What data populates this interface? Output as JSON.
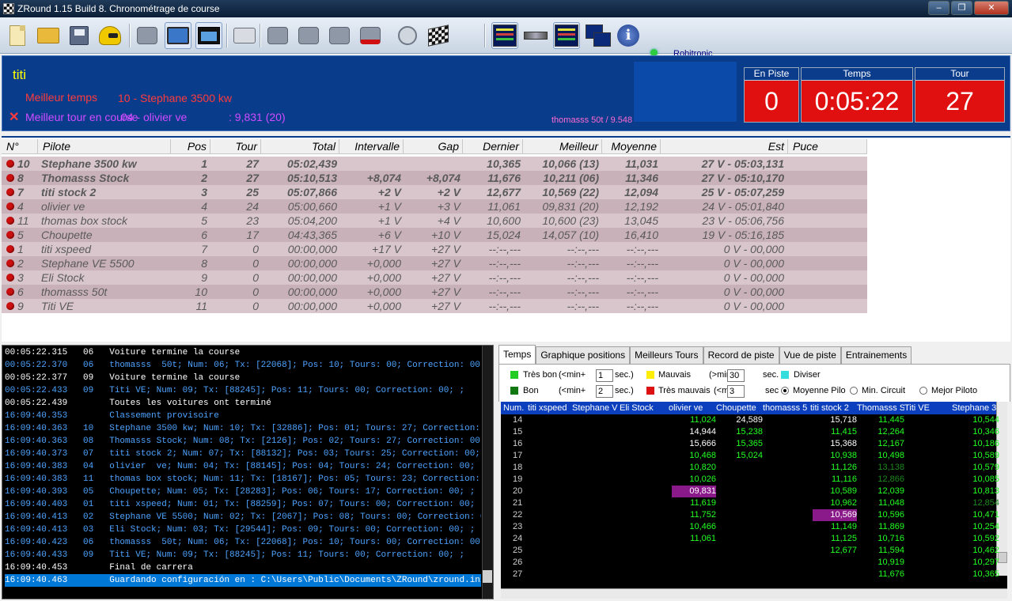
{
  "window": {
    "title": "ZRound 1.15 Build 8. Chronométrage de course"
  },
  "toolbar": {
    "brand": "Robitronic"
  },
  "header": {
    "name": "titi",
    "best_time_label": "Meilleur temps",
    "best_time_value": "10 - Stephane 3500 kw",
    "best_lap_label": "Meilleur tour en course",
    "best_lap_name": "04 - olivier  ve",
    "best_lap_value": ": 9,831 (20)",
    "record": "thomasss  50t / 9.548",
    "stats": [
      {
        "label": "En Piste",
        "value": "0"
      },
      {
        "label": "Temps",
        "value": "0:05:22"
      },
      {
        "label": "Tour",
        "value": "27"
      }
    ]
  },
  "table": {
    "columns": [
      "N°",
      "Pilote",
      "Pos",
      "Tour",
      "Total",
      "Intervalle",
      "Gap",
      "Dernier",
      "Meilleur",
      "Moyenne",
      "Est",
      "Puce"
    ],
    "rows": [
      {
        "num": "10",
        "pilote": "Stephane 3500 kw",
        "pos": "1",
        "tour": "27",
        "total": "05:02,439",
        "interval": "",
        "gap": "",
        "dernier": "10,365",
        "meilleur": "10,066 (13)",
        "moyenne": "11,031",
        "est": "27 V - 05:03,131",
        "bold": true
      },
      {
        "num": "8",
        "pilote": "Thomasss Stock",
        "pos": "2",
        "tour": "27",
        "total": "05:10,513",
        "interval": "+8,074",
        "gap": "+8,074",
        "dernier": "11,676",
        "meilleur": "10,211 (06)",
        "moyenne": "11,346",
        "est": "27 V - 05:10,170",
        "bold": true
      },
      {
        "num": "7",
        "pilote": "titi stock 2",
        "pos": "3",
        "tour": "25",
        "total": "05:07,866",
        "interval": "+2 V",
        "gap": "+2 V",
        "dernier": "12,677",
        "meilleur": "10,569 (22)",
        "moyenne": "12,094",
        "est": "25 V - 05:07,259",
        "bold": true
      },
      {
        "num": "4",
        "pilote": "olivier  ve",
        "pos": "4",
        "tour": "24",
        "total": "05:00,660",
        "interval": "+1 V",
        "gap": "+3 V",
        "dernier": "11,061",
        "meilleur": "09,831 (20)",
        "moyenne": "12,192",
        "est": "24 V - 05:01,840",
        "bold": false
      },
      {
        "num": "11",
        "pilote": "thomas box stock",
        "pos": "5",
        "tour": "23",
        "total": "05:04,200",
        "interval": "+1 V",
        "gap": "+4 V",
        "dernier": "10,600",
        "meilleur": "10,600 (23)",
        "moyenne": "13,045",
        "est": "23 V - 05:06,756",
        "bold": false
      },
      {
        "num": "5",
        "pilote": "Choupette",
        "pos": "6",
        "tour": "17",
        "total": "04:43,365",
        "interval": "+6 V",
        "gap": "+10 V",
        "dernier": "15,024",
        "meilleur": "14,057 (10)",
        "moyenne": "16,410",
        "est": "19 V - 05:16,185",
        "bold": false
      },
      {
        "num": "1",
        "pilote": "titi xspeed",
        "pos": "7",
        "tour": "0",
        "total": "00:00,000",
        "interval": "+17 V",
        "gap": "+27 V",
        "dernier": "--:--,---",
        "meilleur": "--:--,---",
        "moyenne": "--:--,---",
        "est": "0 V - 00,000",
        "bold": false
      },
      {
        "num": "2",
        "pilote": "Stephane VE 5500",
        "pos": "8",
        "tour": "0",
        "total": "00:00,000",
        "interval": "+0,000",
        "gap": "+27 V",
        "dernier": "--:--,---",
        "meilleur": "--:--,---",
        "moyenne": "--:--,---",
        "est": "0 V - 00,000",
        "bold": false
      },
      {
        "num": "3",
        "pilote": "Eli Stock",
        "pos": "9",
        "tour": "0",
        "total": "00:00,000",
        "interval": "+0,000",
        "gap": "+27 V",
        "dernier": "--:--,---",
        "meilleur": "--:--,---",
        "moyenne": "--:--,---",
        "est": "0 V - 00,000",
        "bold": false
      },
      {
        "num": "6",
        "pilote": "thomasss  50t",
        "pos": "10",
        "tour": "0",
        "total": "00:00,000",
        "interval": "+0,000",
        "gap": "+27 V",
        "dernier": "--:--,---",
        "meilleur": "--:--,---",
        "moyenne": "--:--,---",
        "est": "0 V - 00,000",
        "bold": false
      },
      {
        "num": "9",
        "pilote": "Titi VE",
        "pos": "11",
        "tour": "0",
        "total": "00:00,000",
        "interval": "+0,000",
        "gap": "+27 V",
        "dernier": "--:--,---",
        "meilleur": "--:--,---",
        "moyenne": "--:--,---",
        "est": "0 V - 00,000",
        "bold": false
      }
    ]
  },
  "log": [
    {
      "time": "00:05:22.315",
      "num": "06",
      "text": "Voiture termine la course",
      "color": "white"
    },
    {
      "time": "00:05:22.370",
      "num": "06",
      "text": "thomasss  50t; Num: 06; Tx: [22068]; Pos: 10; Tours: 00; Correction: 00; ;",
      "color": "blue"
    },
    {
      "time": "00:05:22.377",
      "num": "09",
      "text": "Voiture termine la course",
      "color": "white"
    },
    {
      "time": "00:05:22.433",
      "num": "09",
      "text": "Titi VE; Num: 09; Tx: [88245]; Pos: 11; Tours: 00; Correction: 00; ;",
      "color": "blue"
    },
    {
      "time": "00:05:22.439",
      "num": "",
      "text": "Toutes les voitures ont terminé",
      "color": "white"
    },
    {
      "time": "16:09:40.353",
      "num": "",
      "text": "Classement provisoire",
      "color": "blue"
    },
    {
      "time": "16:09:40.363",
      "num": "10",
      "text": "Stephane 3500 kw; Num: 10; Tx: [32886]; Pos: 01; Tours: 27; Correction: 00;",
      "color": "blue"
    },
    {
      "time": "16:09:40.363",
      "num": "08",
      "text": "Thomasss Stock; Num: 08; Tx: [2126]; Pos: 02; Tours: 27; Correction: 00; ;",
      "color": "blue"
    },
    {
      "time": "16:09:40.373",
      "num": "07",
      "text": "titi stock 2; Num: 07; Tx: [88132]; Pos: 03; Tours: 25; Correction: 00; ;",
      "color": "blue"
    },
    {
      "time": "16:09:40.383",
      "num": "04",
      "text": "olivier  ve; Num: 04; Tx: [88145]; Pos: 04; Tours: 24; Correction: 00; ;",
      "color": "blue"
    },
    {
      "time": "16:09:40.383",
      "num": "11",
      "text": "thomas box stock; Num: 11; Tx: [18167]; Pos: 05; Tours: 23; Correction: 00;",
      "color": "blue"
    },
    {
      "time": "16:09:40.393",
      "num": "05",
      "text": "Choupette; Num: 05; Tx: [28283]; Pos: 06; Tours: 17; Correction: 00; ;",
      "color": "blue"
    },
    {
      "time": "16:09:40.403",
      "num": "01",
      "text": "titi xspeed; Num: 01; Tx: [88259]; Pos: 07; Tours: 00; Correction: 00; ;",
      "color": "blue"
    },
    {
      "time": "16:09:40.413",
      "num": "02",
      "text": "Stephane VE 5500; Num: 02; Tx: [2067]; Pos: 08; Tours: 00; Correction: 00;",
      "color": "blue"
    },
    {
      "time": "16:09:40.413",
      "num": "03",
      "text": "Eli Stock; Num: 03; Tx: [29544]; Pos: 09; Tours: 00; Correction: 00; ;",
      "color": "blue"
    },
    {
      "time": "16:09:40.423",
      "num": "06",
      "text": "thomasss  50t; Num: 06; Tx: [22068]; Pos: 10; Tours: 00; Correction: 00; ;",
      "color": "blue"
    },
    {
      "time": "16:09:40.433",
      "num": "09",
      "text": "Titi VE; Num: 09; Tx: [88245]; Pos: 11; Tours: 00; Correction: 00; ;",
      "color": "blue"
    },
    {
      "time": "16:09:40.453",
      "num": "",
      "text": "Final de carrera",
      "color": "white"
    },
    {
      "time": "16:09:40.463",
      "num": "",
      "text": "Guardando configuración en : C:\\Users\\Public\\Documents\\ZRound\\zround.ini",
      "color": "selected"
    }
  ],
  "right_panel": {
    "tabs": [
      "Temps",
      "Graphique positions",
      "Meilleurs Tours",
      "Record de piste",
      "Vue de piste",
      "Entrainements"
    ],
    "options": {
      "tres_bon_label": "Très bon",
      "tres_bon_rule": "(<min+",
      "tres_bon_value": "1",
      "tres_bon_unit": "sec.)",
      "bon_label": "Bon",
      "bon_rule": "(<min+",
      "bon_value": "2",
      "bon_unit": "sec.)",
      "mauvais_label": "Mauvais",
      "mauvais_rule": "(>min",
      "mauvais_value": "30",
      "mauvais_unit": "sec.",
      "tres_mauvais_label": "Très mauvais",
      "tres_mauvais_rule": "(<min",
      "tres_mauvais_value": "3",
      "tres_mauvais_unit": "sec",
      "diviser_label": "Diviser",
      "moyenne_label": "Moyenne Pilo",
      "min_circuit_label": "Min. Circuit",
      "mejor_label": "Mejor Piloto",
      "colors": {
        "tres_bon": "#22cc22",
        "bon": "#117711",
        "mauvais": "#ffee00",
        "tres_mauvais": "#dd1111",
        "diviser": "#33dddd"
      }
    },
    "grid": {
      "columns": [
        "Num.",
        "titi xspeed",
        "Stephane V",
        "Eli Stock",
        "olivier  ve",
        "Choupette",
        "thomasss  5",
        "titi stock 2",
        "Thomasss S",
        "Titi VE",
        "Stephane 3"
      ],
      "rows": [
        {
          "n": "14",
          "cells": {
            "c4": [
              "11,024",
              "g"
            ],
            "c5": [
              "24,589",
              "w"
            ],
            "c7": [
              "15,718",
              "w"
            ],
            "c8": [
              "11,445",
              "g"
            ],
            "c10": [
              "10,544",
              "g"
            ]
          }
        },
        {
          "n": "15",
          "cells": {
            "c4": [
              "14,944",
              "w"
            ],
            "c5": [
              "15,238",
              "g"
            ],
            "c7": [
              "11,415",
              "g"
            ],
            "c8": [
              "12,264",
              "g"
            ],
            "c10": [
              "10,346",
              "g"
            ]
          }
        },
        {
          "n": "16",
          "cells": {
            "c4": [
              "15,666",
              "w"
            ],
            "c5": [
              "15,365",
              "g"
            ],
            "c7": [
              "15,368",
              "w"
            ],
            "c8": [
              "12,167",
              "g"
            ],
            "c10": [
              "10,186",
              "g"
            ]
          }
        },
        {
          "n": "17",
          "cells": {
            "c4": [
              "10,468",
              "g"
            ],
            "c5": [
              "15,024",
              "g"
            ],
            "c7": [
              "10,938",
              "g"
            ],
            "c8": [
              "10,498",
              "g"
            ],
            "c10": [
              "10,589",
              "g"
            ]
          }
        },
        {
          "n": "18",
          "cells": {
            "c4": [
              "10,820",
              "g"
            ],
            "c7": [
              "11,126",
              "g"
            ],
            "c8": [
              "13,138",
              "d"
            ],
            "c10": [
              "10,579",
              "g"
            ]
          }
        },
        {
          "n": "19",
          "cells": {
            "c4": [
              "10,026",
              "g"
            ],
            "c7": [
              "11,116",
              "g"
            ],
            "c8": [
              "12,866",
              "d"
            ],
            "c10": [
              "10,085",
              "g"
            ]
          }
        },
        {
          "n": "20",
          "cells": {
            "c4": [
              "09,831",
              "p"
            ],
            "c7": [
              "10,589",
              "g"
            ],
            "c8": [
              "12,039",
              "g"
            ],
            "c10": [
              "10,813",
              "g"
            ]
          }
        },
        {
          "n": "21",
          "cells": {
            "c4": [
              "11,619",
              "g"
            ],
            "c7": [
              "10,962",
              "g"
            ],
            "c8": [
              "11,048",
              "g"
            ],
            "c10": [
              "12,854",
              "d"
            ]
          }
        },
        {
          "n": "22",
          "cells": {
            "c4": [
              "11,752",
              "g"
            ],
            "c7": [
              "10,569",
              "p"
            ],
            "c8": [
              "10,596",
              "g"
            ],
            "c10": [
              "10,471",
              "g"
            ]
          }
        },
        {
          "n": "23",
          "cells": {
            "c4": [
              "10,466",
              "g"
            ],
            "c7": [
              "11,149",
              "g"
            ],
            "c8": [
              "11,869",
              "g"
            ],
            "c10": [
              "10,254",
              "g"
            ]
          }
        },
        {
          "n": "24",
          "cells": {
            "c4": [
              "11,061",
              "g"
            ],
            "c7": [
              "11,125",
              "g"
            ],
            "c8": [
              "10,716",
              "g"
            ],
            "c10": [
              "10,592",
              "g"
            ]
          }
        },
        {
          "n": "25",
          "cells": {
            "c7": [
              "12,677",
              "g"
            ],
            "c8": [
              "11,594",
              "g"
            ],
            "c10": [
              "10,462",
              "g"
            ]
          }
        },
        {
          "n": "26",
          "cells": {
            "c8": [
              "10,919",
              "g"
            ],
            "c10": [
              "10,297",
              "g"
            ]
          }
        },
        {
          "n": "27",
          "cells": {
            "c8": [
              "11,676",
              "g"
            ],
            "c10": [
              "10,365",
              "g"
            ]
          }
        }
      ]
    }
  }
}
